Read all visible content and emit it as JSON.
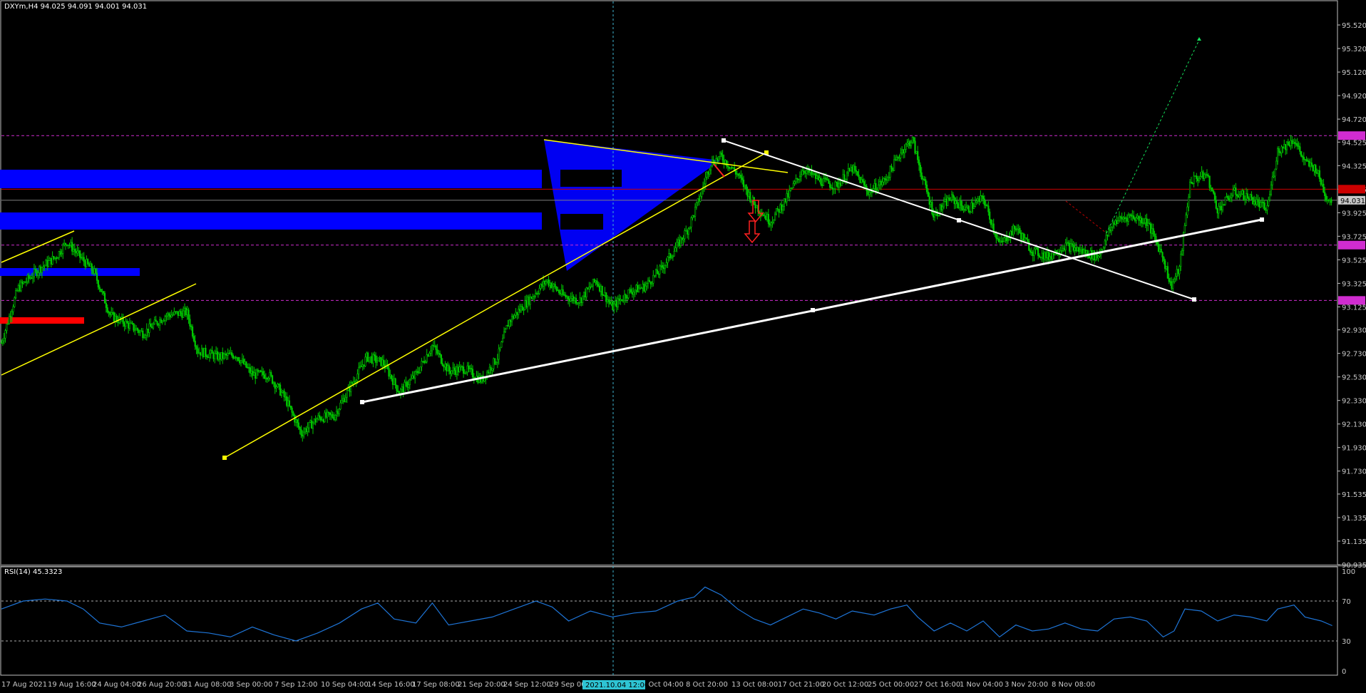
{
  "header": {
    "symbol": "DXYm,H4",
    "ohlc": "94.025 94.091 94.001 94.031"
  },
  "rsi": {
    "label": "RSI(14) 45.3323",
    "levels": [
      "100",
      "70",
      "30",
      "0"
    ]
  },
  "colors": {
    "background": "#000000",
    "candle": "#00c800",
    "zone": "#0000ff",
    "trendline_yellow": "#ffff00",
    "trendline_white": "#ffffff",
    "level_magenta": "#d02cd0",
    "level_red": "#cc0000",
    "rsi_line": "#1e74d6",
    "arrow_red": "#ff2020",
    "projection_green": "#14e05a"
  },
  "chart_data": [
    {
      "type": "line",
      "description": "DXYm H4 price chart",
      "yaxis_ticks": [
        "95.520",
        "95.320",
        "95.120",
        "94.920",
        "94.720",
        "94.525",
        "94.325",
        "94.125",
        "93.925",
        "93.725",
        "93.525",
        "93.325",
        "93.125",
        "92.930",
        "92.730",
        "92.530",
        "92.330",
        "92.130",
        "91.930",
        "91.730",
        "91.535",
        "91.335",
        "91.135",
        "90.935"
      ],
      "ylim": [
        90.935,
        95.72
      ],
      "xaxis_labels": [
        "17 Aug 2021",
        "19 Aug 16:00",
        "24 Aug 04:00",
        "26 Aug 20:00",
        "31 Aug 08:00",
        "3 Sep 00:00",
        "7 Sep 12:00",
        "10 Sep 04:00",
        "14 Sep 16:00",
        "17 Sep 08:00",
        "21 Sep 20:00",
        "24 Sep 12:00",
        "29 Sep 00:00",
        "5 Oct 04:00",
        "8 Oct 20:00",
        "13 Oct 08:00",
        "17 Oct 21:00",
        "20 Oct 12:00",
        "25 Oct 00:00",
        "27 Oct 16:00",
        "1 Nov 04:00",
        "3 Nov 20:00",
        "8 Nov 08:00"
      ],
      "crosshair_label": "2021.10.04 12:00",
      "current_price": "94.031",
      "price_tags": [
        {
          "value": 94.58,
          "color": "#d02cd0"
        },
        {
          "value": 94.125,
          "color": "#cc0000"
        },
        {
          "value": 94.031,
          "color": "#c8c8c8"
        },
        {
          "value": 93.65,
          "color": "#d02cd0"
        },
        {
          "value": 93.18,
          "color": "#d02cd0"
        }
      ],
      "horizontal_levels": [
        {
          "value": 94.58,
          "color": "#d02cd0",
          "style": "dashed"
        },
        {
          "value": 94.125,
          "color": "#cc0000",
          "style": "solid"
        },
        {
          "value": 94.031,
          "color": "#808080",
          "style": "solid"
        },
        {
          "value": 93.65,
          "color": "#d02cd0",
          "style": "dashed"
        },
        {
          "value": 93.18,
          "color": "#d02cd0",
          "style": "dashed"
        }
      ],
      "price_path": [
        [
          0,
          92.82
        ],
        [
          15,
          93.28
        ],
        [
          35,
          93.45
        ],
        [
          50,
          93.55
        ],
        [
          60,
          93.68
        ],
        [
          72,
          93.55
        ],
        [
          85,
          93.42
        ],
        [
          100,
          93.05
        ],
        [
          115,
          92.98
        ],
        [
          130,
          92.9
        ],
        [
          150,
          93.05
        ],
        [
          170,
          93.08
        ],
        [
          180,
          92.75
        ],
        [
          200,
          92.7
        ],
        [
          215,
          92.72
        ],
        [
          230,
          92.55
        ],
        [
          245,
          92.55
        ],
        [
          260,
          92.35
        ],
        [
          275,
          92.05
        ],
        [
          290,
          92.18
        ],
        [
          305,
          92.2
        ],
        [
          320,
          92.45
        ],
        [
          335,
          92.7
        ],
        [
          350,
          92.65
        ],
        [
          365,
          92.4
        ],
        [
          380,
          92.55
        ],
        [
          395,
          92.8
        ],
        [
          410,
          92.58
        ],
        [
          425,
          92.6
        ],
        [
          440,
          92.5
        ],
        [
          455,
          92.7
        ],
        [
          465,
          93.0
        ],
        [
          480,
          93.15
        ],
        [
          500,
          93.35
        ],
        [
          515,
          93.22
        ],
        [
          530,
          93.18
        ],
        [
          545,
          93.35
        ],
        [
          560,
          93.12
        ],
        [
          575,
          93.25
        ],
        [
          590,
          93.3
        ],
        [
          605,
          93.45
        ],
        [
          620,
          93.65
        ],
        [
          630,
          93.8
        ],
        [
          640,
          94.05
        ],
        [
          650,
          94.35
        ],
        [
          660,
          94.4
        ],
        [
          675,
          94.25
        ],
        [
          690,
          94.0
        ],
        [
          705,
          93.85
        ],
        [
          720,
          94.05
        ],
        [
          735,
          94.3
        ],
        [
          750,
          94.2
        ],
        [
          765,
          94.15
        ],
        [
          780,
          94.3
        ],
        [
          795,
          94.1
        ],
        [
          810,
          94.2
        ],
        [
          825,
          94.45
        ],
        [
          835,
          94.55
        ],
        [
          845,
          94.2
        ],
        [
          855,
          93.9
        ],
        [
          870,
          94.05
        ],
        [
          885,
          93.95
        ],
        [
          900,
          94.05
        ],
        [
          915,
          93.65
        ],
        [
          930,
          93.8
        ],
        [
          945,
          93.6
        ],
        [
          960,
          93.55
        ],
        [
          975,
          93.65
        ],
        [
          990,
          93.6
        ],
        [
          1005,
          93.55
        ],
        [
          1020,
          93.85
        ],
        [
          1035,
          93.9
        ],
        [
          1050,
          93.85
        ],
        [
          1065,
          93.55
        ],
        [
          1072,
          93.3
        ],
        [
          1080,
          93.45
        ],
        [
          1090,
          94.2
        ],
        [
          1105,
          94.25
        ],
        [
          1115,
          93.95
        ],
        [
          1130,
          94.1
        ],
        [
          1145,
          94.05
        ],
        [
          1160,
          93.95
        ],
        [
          1170,
          94.45
        ],
        [
          1185,
          94.55
        ],
        [
          1195,
          94.35
        ],
        [
          1205,
          94.3
        ],
        [
          1215,
          94.05
        ],
        [
          1220,
          94.031
        ]
      ],
      "path_x_note": "path x is candle index"
    },
    {
      "type": "line",
      "description": "RSI(14) indicator",
      "ylim": [
        0,
        100
      ],
      "levels": [
        70,
        30
      ],
      "value": 45.3323,
      "series": [
        {
          "values": [
            [
              0,
              62
            ],
            [
              20,
              70
            ],
            [
              40,
              72
            ],
            [
              60,
              70
            ],
            [
              75,
              62
            ],
            [
              90,
              48
            ],
            [
              110,
              44
            ],
            [
              130,
              50
            ],
            [
              150,
              56
            ],
            [
              170,
              40
            ],
            [
              190,
              38
            ],
            [
              210,
              34
            ],
            [
              230,
              44
            ],
            [
              250,
              36
            ],
            [
              270,
              30
            ],
            [
              290,
              38
            ],
            [
              310,
              48
            ],
            [
              330,
              62
            ],
            [
              345,
              68
            ],
            [
              360,
              52
            ],
            [
              380,
              48
            ],
            [
              395,
              68
            ],
            [
              410,
              46
            ],
            [
              430,
              50
            ],
            [
              450,
              54
            ],
            [
              470,
              62
            ],
            [
              490,
              70
            ],
            [
              505,
              64
            ],
            [
              520,
              50
            ],
            [
              540,
              60
            ],
            [
              560,
              54
            ],
            [
              580,
              58
            ],
            [
              600,
              60
            ],
            [
              620,
              70
            ],
            [
              635,
              74
            ],
            [
              645,
              84
            ],
            [
              660,
              76
            ],
            [
              675,
              62
            ],
            [
              690,
              52
            ],
            [
              705,
              46
            ],
            [
              720,
              54
            ],
            [
              735,
              62
            ],
            [
              750,
              58
            ],
            [
              765,
              52
            ],
            [
              780,
              60
            ],
            [
              800,
              56
            ],
            [
              815,
              62
            ],
            [
              830,
              66
            ],
            [
              840,
              54
            ],
            [
              855,
              40
            ],
            [
              870,
              48
            ],
            [
              885,
              40
            ],
            [
              900,
              50
            ],
            [
              915,
              34
            ],
            [
              930,
              46
            ],
            [
              945,
              40
            ],
            [
              960,
              42
            ],
            [
              975,
              48
            ],
            [
              990,
              42
            ],
            [
              1005,
              40
            ],
            [
              1020,
              52
            ],
            [
              1035,
              54
            ],
            [
              1050,
              50
            ],
            [
              1065,
              34
            ],
            [
              1075,
              40
            ],
            [
              1085,
              62
            ],
            [
              1100,
              60
            ],
            [
              1115,
              50
            ],
            [
              1130,
              56
            ],
            [
              1145,
              54
            ],
            [
              1160,
              50
            ],
            [
              1170,
              62
            ],
            [
              1185,
              66
            ],
            [
              1195,
              54
            ],
            [
              1210,
              50
            ],
            [
              1220,
              45.33
            ]
          ]
        }
      ]
    }
  ]
}
